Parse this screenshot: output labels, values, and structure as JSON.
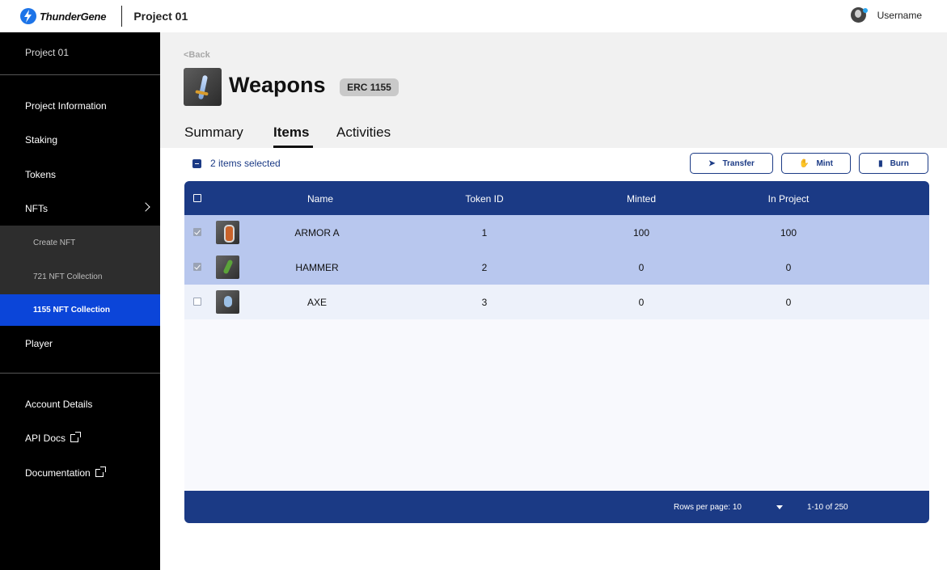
{
  "brand": {
    "name": "ThunderGene",
    "accent": "#1b3a85"
  },
  "topbar": {
    "project": "Project 01",
    "username": "Username"
  },
  "sidebar": {
    "project": "Project 01",
    "items": [
      "Project Information",
      "Staking",
      "Tokens",
      "NFTs"
    ],
    "nft_subitems": [
      "Create NFT",
      "721 NFT Collection",
      "1155 NFT Collection"
    ],
    "player": "Player",
    "bottom_items": [
      "Account Details",
      "API Docs",
      "Documentation"
    ]
  },
  "header": {
    "back": "<Back",
    "title": "Weapons",
    "badge": "ERC 1155",
    "tabs": [
      "Summary",
      "Items",
      "Activities"
    ],
    "active_tab": "Items"
  },
  "actions": {
    "selected_text": "2 items selected",
    "transfer": "Transfer",
    "mint": "Mint",
    "burn": "Burn"
  },
  "table": {
    "columns": [
      "Name",
      "Token ID",
      "Minted",
      "In Project"
    ],
    "rows": [
      {
        "name": "ARMOR A",
        "token_id": "1",
        "minted": "100",
        "in_project": "100",
        "selected": true,
        "icon": "armor-thumbnail"
      },
      {
        "name": "HAMMER",
        "token_id": "2",
        "minted": "0",
        "in_project": "0",
        "selected": true,
        "icon": "hammer-thumbnail"
      },
      {
        "name": "AXE",
        "token_id": "3",
        "minted": "0",
        "in_project": "0",
        "selected": false,
        "icon": "axe-thumbnail"
      }
    ],
    "footer": {
      "rows_per_page": "Rows per page: 10",
      "range": "1-10 of 250"
    }
  }
}
